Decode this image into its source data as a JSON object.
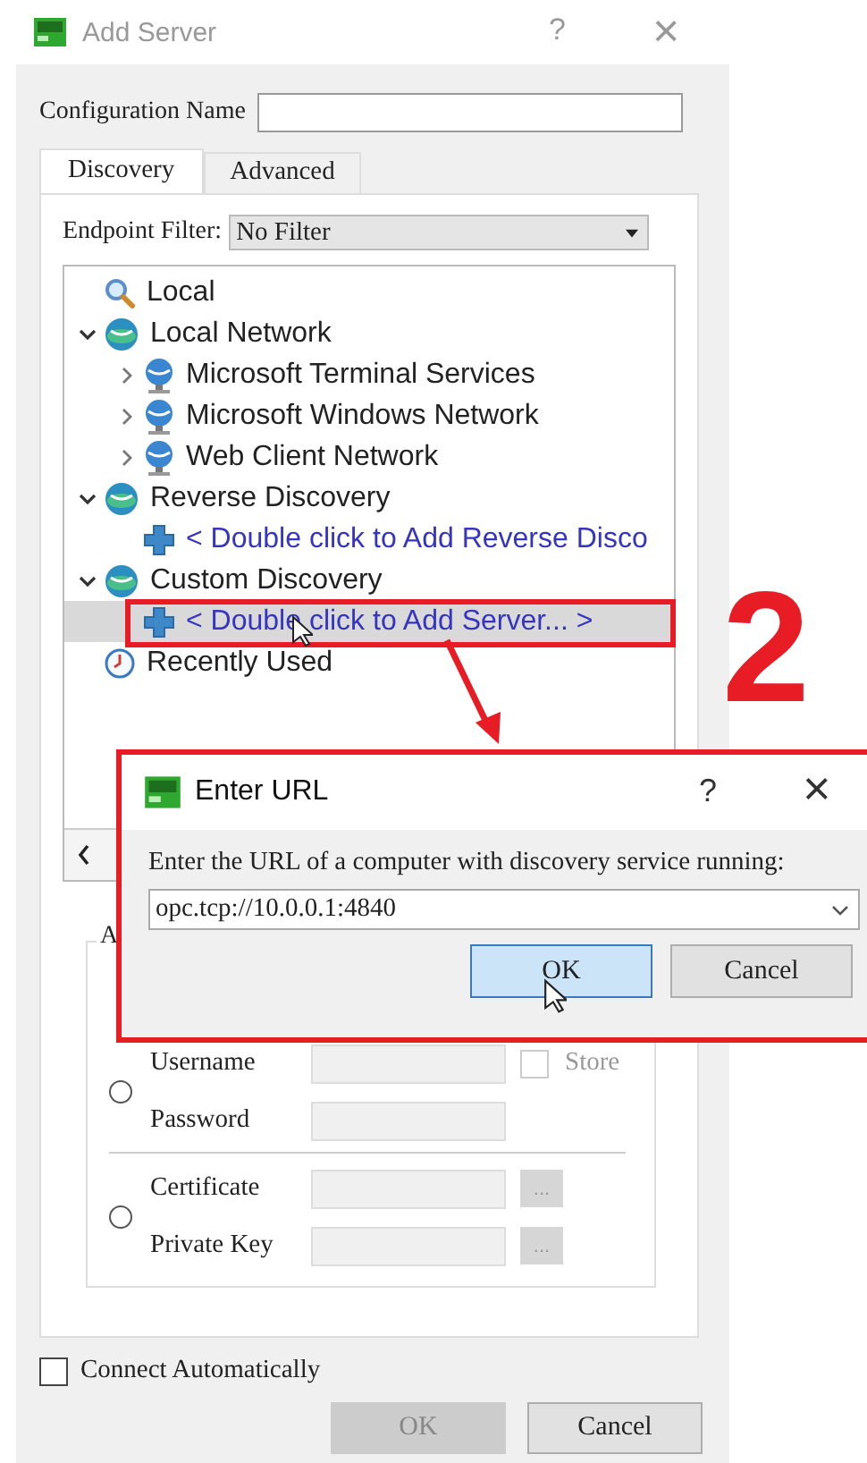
{
  "window": {
    "title": "Add Server",
    "help": "?",
    "close": "×"
  },
  "config_name": {
    "label": "Configuration Name"
  },
  "tabs": [
    {
      "label": "Discovery",
      "selected": true
    },
    {
      "label": "Advanced",
      "selected": false
    }
  ],
  "endpoint_filter": {
    "label": "Endpoint Filter:",
    "value": "No Filter"
  },
  "tree": [
    {
      "label": "Local",
      "kind": "local",
      "selected": false
    },
    {
      "label": "Local Network",
      "kind": "group",
      "expanded": true,
      "selected": false,
      "children": [
        {
          "label": "Microsoft Terminal Services",
          "kind": "server-type",
          "expanded": false,
          "selected": false
        },
        {
          "label": "Microsoft Windows Network",
          "kind": "server-type",
          "expanded": false,
          "selected": false
        },
        {
          "label": "Web Client Network",
          "kind": "server-type",
          "expanded": false,
          "selected": false
        }
      ]
    },
    {
      "label": "Reverse Discovery",
      "kind": "group",
      "expanded": true,
      "selected": false,
      "children": [
        {
          "label": "< Double click to Add Reverse Disco",
          "kind": "action",
          "selected": false
        }
      ]
    },
    {
      "label": "Custom Discovery",
      "kind": "group",
      "expanded": true,
      "selected": false,
      "children": [
        {
          "label": "< Double click to Add Server... >",
          "kind": "action",
          "selected": true
        }
      ]
    },
    {
      "label": "Recently Used",
      "kind": "recent",
      "selected": false
    }
  ],
  "auth": {
    "group_label": "A",
    "options": [
      {
        "selected": false,
        "rows": [
          {
            "kind": "store",
            "label": "Username",
            "store_label": "Store",
            "checked": false
          },
          {
            "kind": "plain",
            "label": "Password"
          }
        ]
      },
      {
        "selected": false,
        "rows": [
          {
            "kind": "file",
            "label": "Certificate",
            "button": "..."
          },
          {
            "kind": "file",
            "label": "Private Key",
            "button": "..."
          }
        ]
      }
    ]
  },
  "connect_automatically": {
    "label": "Connect Automatically",
    "checked": false
  },
  "buttons": [
    {
      "label": "OK",
      "disabled": true
    },
    {
      "label": "Cancel",
      "disabled": false
    }
  ],
  "enter_url_dialog": {
    "title": "Enter URL",
    "help": "?",
    "close": "×",
    "prompt": "Enter the URL of a computer with discovery service running:",
    "value": "opc.tcp://10.0.0.1:4840",
    "buttons": [
      {
        "label": "OK",
        "focused": true
      },
      {
        "label": "Cancel",
        "focused": false
      }
    ]
  },
  "annotation": {
    "step": "2"
  }
}
